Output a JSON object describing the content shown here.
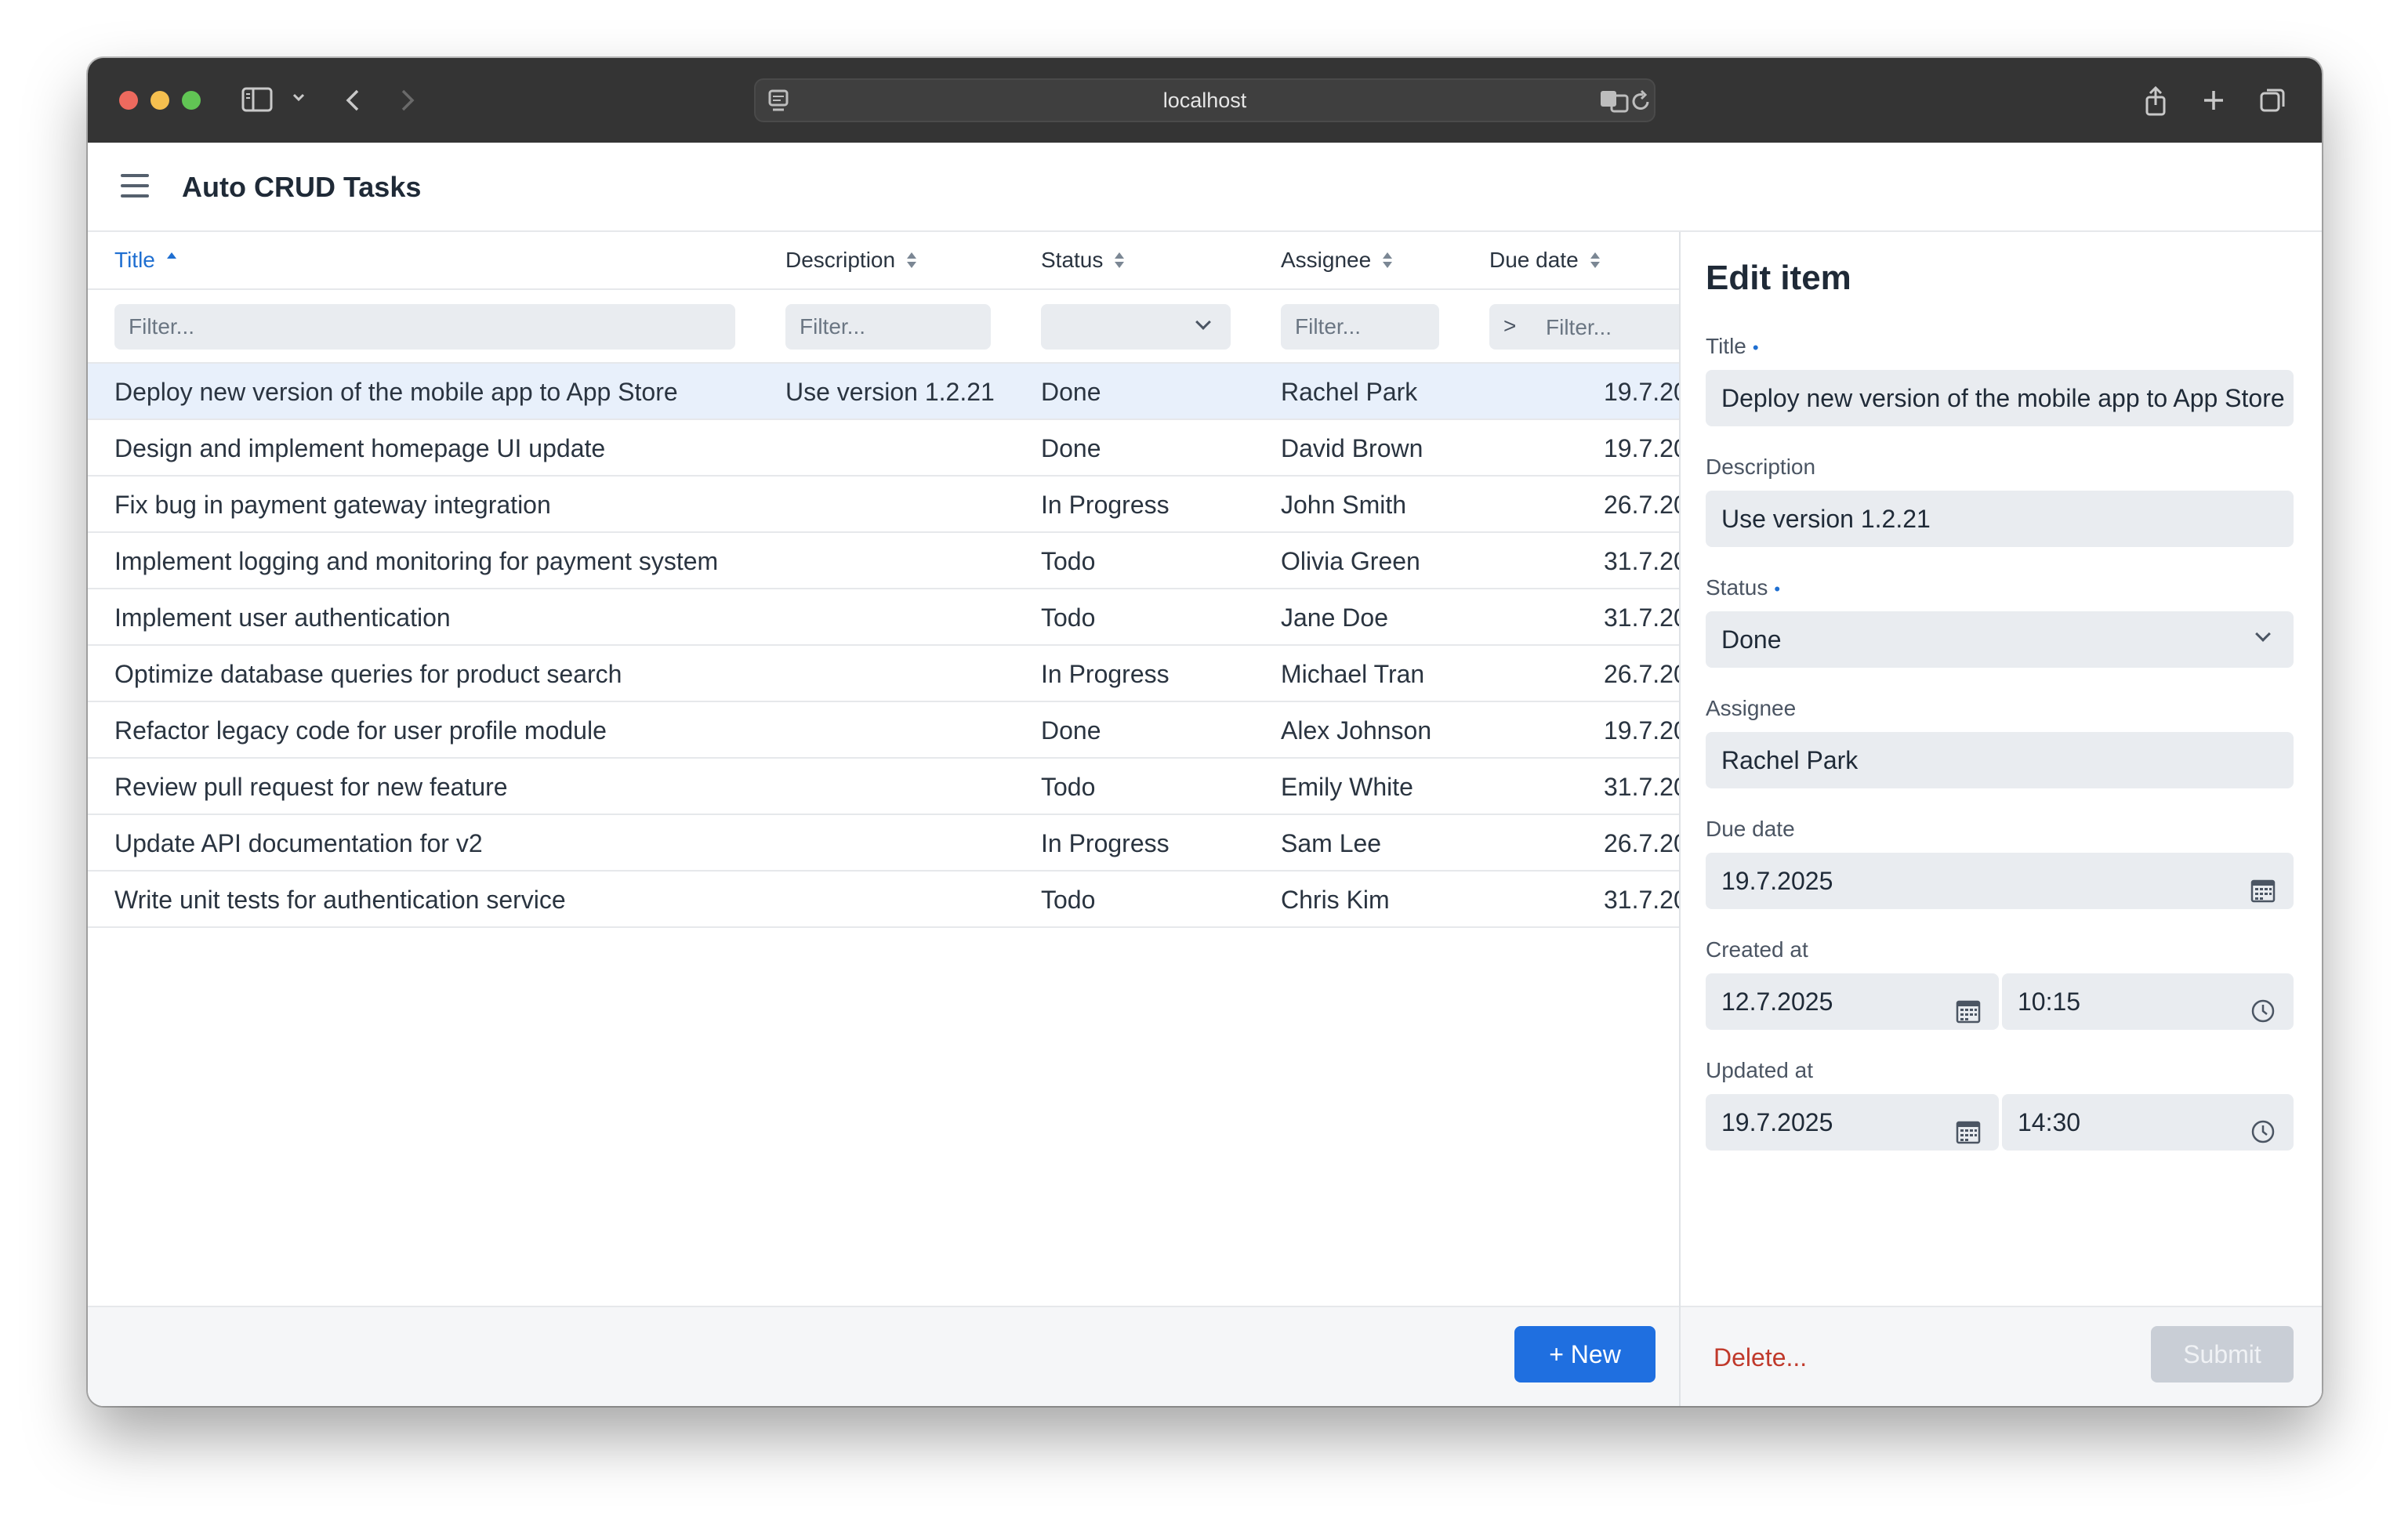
{
  "browser": {
    "url": "localhost"
  },
  "app": {
    "title": "Auto CRUD Tasks"
  },
  "grid": {
    "columns": [
      {
        "label": "Title",
        "sort": "asc"
      },
      {
        "label": "Description",
        "sort": "none"
      },
      {
        "label": "Status",
        "sort": "none"
      },
      {
        "label": "Assignee",
        "sort": "none"
      },
      {
        "label": "Due date",
        "sort": "none"
      }
    ],
    "filters": {
      "title_placeholder": "Filter...",
      "description_placeholder": "Filter...",
      "status_value": "",
      "assignee_placeholder": "Filter...",
      "due_operator": ">",
      "due_placeholder": "Filter..."
    },
    "rows": [
      {
        "title": "Deploy new version of the mobile app to App Store",
        "description": "Use version 1.2.21",
        "status": "Done",
        "assignee": "Rachel Park",
        "due": "19.7.20"
      },
      {
        "title": "Design and implement homepage UI update",
        "description": "",
        "status": "Done",
        "assignee": "David Brown",
        "due": "19.7.20"
      },
      {
        "title": "Fix bug in payment gateway integration",
        "description": "",
        "status": "In Progress",
        "assignee": "John Smith",
        "due": "26.7.20"
      },
      {
        "title": "Implement logging and monitoring for payment system",
        "description": "",
        "status": "Todo",
        "assignee": "Olivia Green",
        "due": "31.7.20"
      },
      {
        "title": "Implement user authentication",
        "description": "",
        "status": "Todo",
        "assignee": "Jane Doe",
        "due": "31.7.20"
      },
      {
        "title": "Optimize database queries for product search",
        "description": "",
        "status": "In Progress",
        "assignee": "Michael Tran",
        "due": "26.7.20"
      },
      {
        "title": "Refactor legacy code for user profile module",
        "description": "",
        "status": "Done",
        "assignee": "Alex Johnson",
        "due": "19.7.20"
      },
      {
        "title": "Review pull request for new feature",
        "description": "",
        "status": "Todo",
        "assignee": "Emily White",
        "due": "31.7.20"
      },
      {
        "title": "Update API documentation for v2",
        "description": "",
        "status": "In Progress",
        "assignee": "Sam Lee",
        "due": "26.7.20"
      },
      {
        "title": "Write unit tests for authentication service",
        "description": "",
        "status": "Todo",
        "assignee": "Chris Kim",
        "due": "31.7.20"
      }
    ],
    "new_button": "+ New"
  },
  "editor": {
    "heading": "Edit item",
    "title_label": "Title",
    "title_value": "Deploy new version of the mobile app to App Store",
    "description_label": "Description",
    "description_value": "Use version 1.2.21",
    "status_label": "Status",
    "status_value": "Done",
    "assignee_label": "Assignee",
    "assignee_value": "Rachel Park",
    "due_label": "Due date",
    "due_value": "19.7.2025",
    "created_label": "Created at",
    "created_date": "12.7.2025",
    "created_time": "10:15",
    "updated_label": "Updated at",
    "updated_date": "19.7.2025",
    "updated_time": "14:30",
    "delete_button": "Delete...",
    "submit_button": "Submit"
  },
  "colors": {
    "accent": "#1f6fe0",
    "selected_row": "#e8f0fb",
    "danger": "#c0392b"
  }
}
